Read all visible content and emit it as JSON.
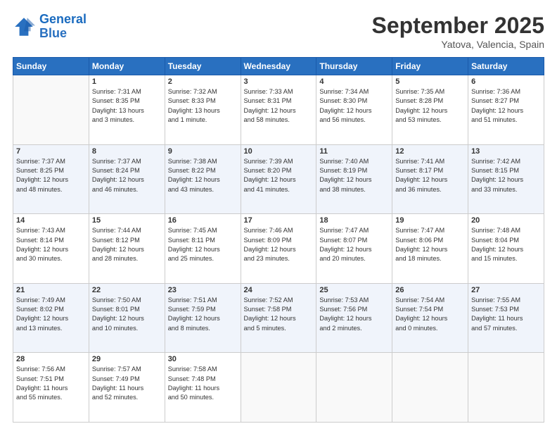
{
  "header": {
    "logo_line1": "General",
    "logo_line2": "Blue",
    "month": "September 2025",
    "location": "Yatova, Valencia, Spain"
  },
  "weekdays": [
    "Sunday",
    "Monday",
    "Tuesday",
    "Wednesday",
    "Thursday",
    "Friday",
    "Saturday"
  ],
  "weeks": [
    [
      {
        "day": "",
        "info": ""
      },
      {
        "day": "1",
        "info": "Sunrise: 7:31 AM\nSunset: 8:35 PM\nDaylight: 13 hours\nand 3 minutes."
      },
      {
        "day": "2",
        "info": "Sunrise: 7:32 AM\nSunset: 8:33 PM\nDaylight: 13 hours\nand 1 minute."
      },
      {
        "day": "3",
        "info": "Sunrise: 7:33 AM\nSunset: 8:31 PM\nDaylight: 12 hours\nand 58 minutes."
      },
      {
        "day": "4",
        "info": "Sunrise: 7:34 AM\nSunset: 8:30 PM\nDaylight: 12 hours\nand 56 minutes."
      },
      {
        "day": "5",
        "info": "Sunrise: 7:35 AM\nSunset: 8:28 PM\nDaylight: 12 hours\nand 53 minutes."
      },
      {
        "day": "6",
        "info": "Sunrise: 7:36 AM\nSunset: 8:27 PM\nDaylight: 12 hours\nand 51 minutes."
      }
    ],
    [
      {
        "day": "7",
        "info": "Sunrise: 7:37 AM\nSunset: 8:25 PM\nDaylight: 12 hours\nand 48 minutes."
      },
      {
        "day": "8",
        "info": "Sunrise: 7:37 AM\nSunset: 8:24 PM\nDaylight: 12 hours\nand 46 minutes."
      },
      {
        "day": "9",
        "info": "Sunrise: 7:38 AM\nSunset: 8:22 PM\nDaylight: 12 hours\nand 43 minutes."
      },
      {
        "day": "10",
        "info": "Sunrise: 7:39 AM\nSunset: 8:20 PM\nDaylight: 12 hours\nand 41 minutes."
      },
      {
        "day": "11",
        "info": "Sunrise: 7:40 AM\nSunset: 8:19 PM\nDaylight: 12 hours\nand 38 minutes."
      },
      {
        "day": "12",
        "info": "Sunrise: 7:41 AM\nSunset: 8:17 PM\nDaylight: 12 hours\nand 36 minutes."
      },
      {
        "day": "13",
        "info": "Sunrise: 7:42 AM\nSunset: 8:15 PM\nDaylight: 12 hours\nand 33 minutes."
      }
    ],
    [
      {
        "day": "14",
        "info": "Sunrise: 7:43 AM\nSunset: 8:14 PM\nDaylight: 12 hours\nand 30 minutes."
      },
      {
        "day": "15",
        "info": "Sunrise: 7:44 AM\nSunset: 8:12 PM\nDaylight: 12 hours\nand 28 minutes."
      },
      {
        "day": "16",
        "info": "Sunrise: 7:45 AM\nSunset: 8:11 PM\nDaylight: 12 hours\nand 25 minutes."
      },
      {
        "day": "17",
        "info": "Sunrise: 7:46 AM\nSunset: 8:09 PM\nDaylight: 12 hours\nand 23 minutes."
      },
      {
        "day": "18",
        "info": "Sunrise: 7:47 AM\nSunset: 8:07 PM\nDaylight: 12 hours\nand 20 minutes."
      },
      {
        "day": "19",
        "info": "Sunrise: 7:47 AM\nSunset: 8:06 PM\nDaylight: 12 hours\nand 18 minutes."
      },
      {
        "day": "20",
        "info": "Sunrise: 7:48 AM\nSunset: 8:04 PM\nDaylight: 12 hours\nand 15 minutes."
      }
    ],
    [
      {
        "day": "21",
        "info": "Sunrise: 7:49 AM\nSunset: 8:02 PM\nDaylight: 12 hours\nand 13 minutes."
      },
      {
        "day": "22",
        "info": "Sunrise: 7:50 AM\nSunset: 8:01 PM\nDaylight: 12 hours\nand 10 minutes."
      },
      {
        "day": "23",
        "info": "Sunrise: 7:51 AM\nSunset: 7:59 PM\nDaylight: 12 hours\nand 8 minutes."
      },
      {
        "day": "24",
        "info": "Sunrise: 7:52 AM\nSunset: 7:58 PM\nDaylight: 12 hours\nand 5 minutes."
      },
      {
        "day": "25",
        "info": "Sunrise: 7:53 AM\nSunset: 7:56 PM\nDaylight: 12 hours\nand 2 minutes."
      },
      {
        "day": "26",
        "info": "Sunrise: 7:54 AM\nSunset: 7:54 PM\nDaylight: 12 hours\nand 0 minutes."
      },
      {
        "day": "27",
        "info": "Sunrise: 7:55 AM\nSunset: 7:53 PM\nDaylight: 11 hours\nand 57 minutes."
      }
    ],
    [
      {
        "day": "28",
        "info": "Sunrise: 7:56 AM\nSunset: 7:51 PM\nDaylight: 11 hours\nand 55 minutes."
      },
      {
        "day": "29",
        "info": "Sunrise: 7:57 AM\nSunset: 7:49 PM\nDaylight: 11 hours\nand 52 minutes."
      },
      {
        "day": "30",
        "info": "Sunrise: 7:58 AM\nSunset: 7:48 PM\nDaylight: 11 hours\nand 50 minutes."
      },
      {
        "day": "",
        "info": ""
      },
      {
        "day": "",
        "info": ""
      },
      {
        "day": "",
        "info": ""
      },
      {
        "day": "",
        "info": ""
      }
    ]
  ]
}
